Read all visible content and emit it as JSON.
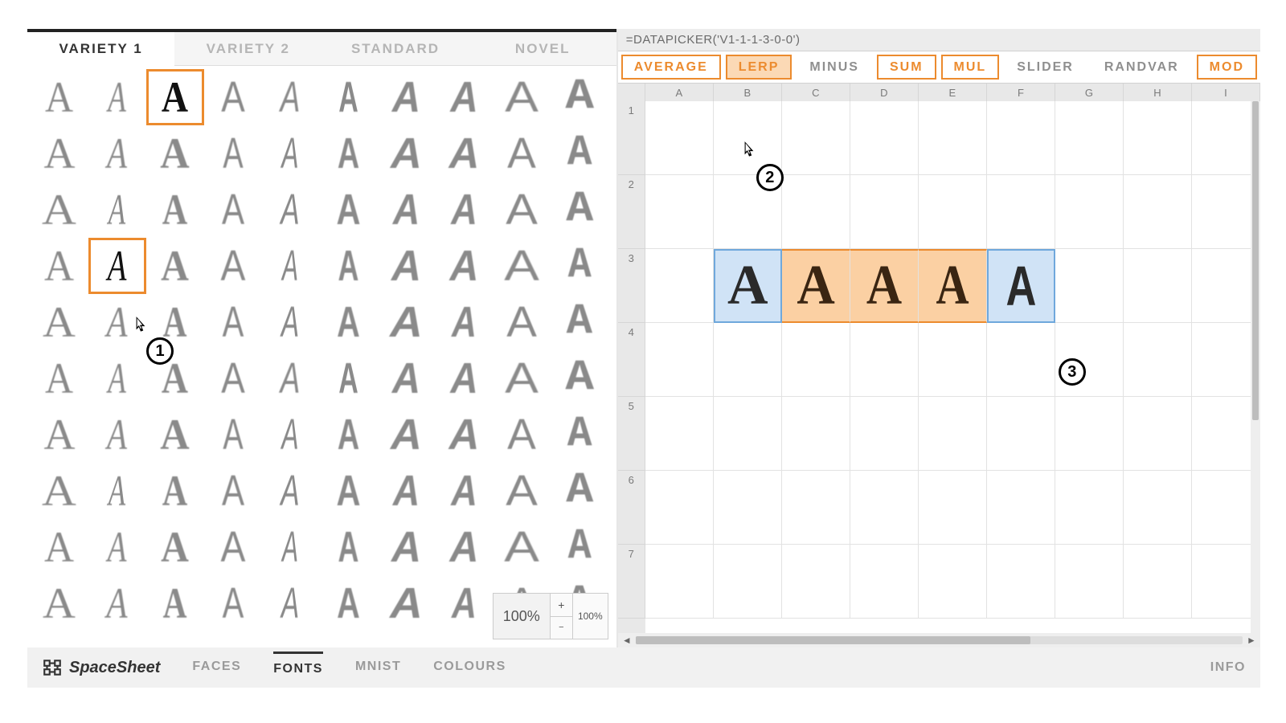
{
  "left_tabs": [
    "VARIETY 1",
    "VARIETY 2",
    "STANDARD",
    "NOVEL"
  ],
  "left_tab_active": 0,
  "glyph_rows": 10,
  "glyph_cols": 10,
  "glyph_variants": [
    {
      "ff": "Georgia",
      "fw": 400,
      "sx": 1.0,
      "fs": "normal"
    },
    {
      "ff": "Georgia",
      "fw": 400,
      "sx": 0.72,
      "fs": "italic"
    },
    {
      "ff": "Georgia",
      "fw": 900,
      "sx": 0.85,
      "fs": "normal"
    },
    {
      "ff": "Arial",
      "fw": 400,
      "sx": 0.78,
      "fs": "normal"
    },
    {
      "ff": "Arial",
      "fw": 300,
      "sx": 0.62,
      "fs": "italic"
    },
    {
      "ff": "Arial",
      "fw": 900,
      "sx": 0.7,
      "fs": "normal"
    },
    {
      "ff": "Arial",
      "fw": 700,
      "sx": 0.95,
      "fs": "italic"
    },
    {
      "ff": "Arial",
      "fw": 900,
      "sx": 0.88,
      "fs": "italic"
    },
    {
      "ff": "Arial",
      "fw": 400,
      "sx": 1.1,
      "fs": "normal"
    },
    {
      "ff": "Courier New",
      "fw": 700,
      "sx": 1.0,
      "fs": "normal"
    }
  ],
  "selected_glyphs": [
    [
      0,
      2
    ],
    [
      3,
      1
    ]
  ],
  "zoom": {
    "value": "100%",
    "plus": "+",
    "minus": "−",
    "reset": "100%"
  },
  "formula": "=DATAPICKER('V1-1-1-3-0-0')",
  "ops": [
    {
      "label": "AVERAGE",
      "accent": true,
      "active": false
    },
    {
      "label": "LERP",
      "accent": true,
      "active": true
    },
    {
      "label": "MINUS",
      "accent": false,
      "active": false
    },
    {
      "label": "SUM",
      "accent": true,
      "active": false
    },
    {
      "label": "MUL",
      "accent": true,
      "active": false
    },
    {
      "label": "SLIDER",
      "accent": false,
      "active": false
    },
    {
      "label": "RANDVAR",
      "accent": false,
      "active": false
    },
    {
      "label": "MOD",
      "accent": true,
      "active": false
    }
  ],
  "columns": [
    "A",
    "B",
    "C",
    "D",
    "E",
    "F",
    "G",
    "H",
    "I"
  ],
  "rows": [
    "1",
    "2",
    "3",
    "4",
    "5",
    "6",
    "7"
  ],
  "lerp_row": 2,
  "lerp_start_col": 1,
  "lerp_end_col": 5,
  "footer": {
    "brand": "SpaceSheet",
    "tabs": [
      "FACES",
      "FONTS",
      "MNIST",
      "COLOURS"
    ],
    "active": 1,
    "info": "INFO"
  },
  "callouts": {
    "1": "1",
    "2": "2",
    "3": "3"
  }
}
